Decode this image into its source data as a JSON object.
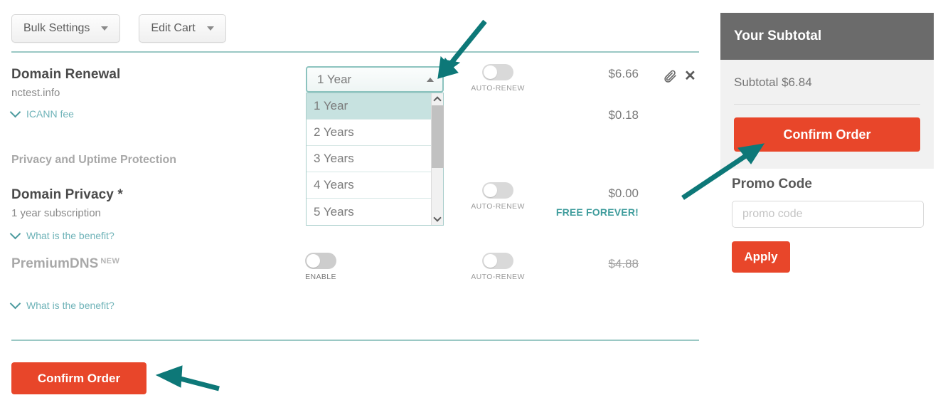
{
  "toolbar": {
    "bulk_settings_label": "Bulk Settings",
    "edit_cart_label": "Edit Cart"
  },
  "cart": {
    "renewal": {
      "title": "Domain Renewal",
      "domain": "nctest.info",
      "icann_label": "ICANN fee",
      "price": "$6.66",
      "icann_price": "$0.18",
      "auto_renew_label": "AUTO-RENEW"
    },
    "privacy_section_heading": "Privacy and Uptime Protection",
    "privacy": {
      "title": "Domain Privacy *",
      "subscription": "1 year subscription",
      "benefit_label": "What is the benefit?",
      "price": "$0.00",
      "free_badge": "FREE FOREVER!",
      "auto_renew_label": "AUTO-RENEW"
    },
    "premiumdns": {
      "title": "PremiumDNS",
      "badge": "NEW",
      "benefit_label": "What is the benefit?",
      "price": "$4.88",
      "enable_label": "ENABLE",
      "auto_renew_label": "AUTO-RENEW"
    },
    "confirm_order_label": "Confirm Order"
  },
  "term_select": {
    "value": "1 Year",
    "options": [
      "1 Year",
      "2 Years",
      "3 Years",
      "4 Years",
      "5 Years"
    ],
    "selected_index": 0,
    "expanded": true
  },
  "subtotal": {
    "header": "Your Subtotal",
    "amount_line": "Subtotal $6.84",
    "confirm_order_label": "Confirm Order"
  },
  "promo": {
    "label": "Promo Code",
    "placeholder": "promo code",
    "value": "",
    "apply_label": "Apply"
  },
  "colors": {
    "accent_orange": "#e8462a",
    "teal": "#4b9a9e",
    "teal_rule": "#9ac8c4",
    "annotation_arrow": "#0d7878",
    "panel_header_gray": "#6b6b6b"
  }
}
